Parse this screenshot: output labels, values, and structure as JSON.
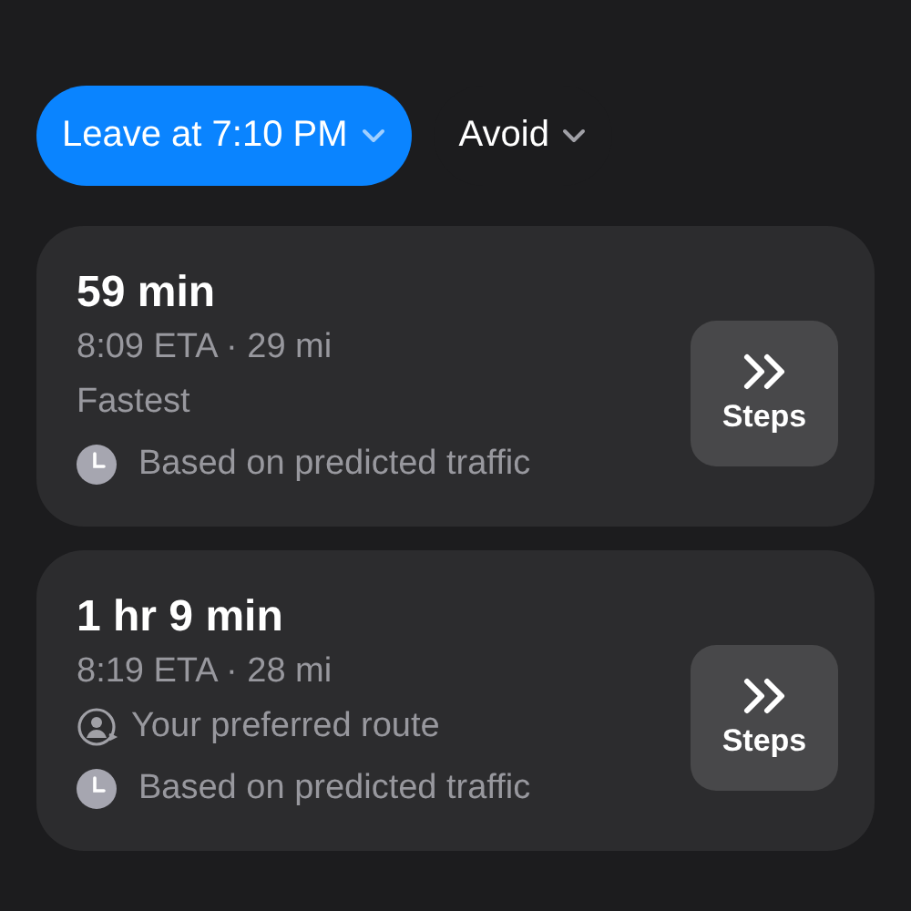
{
  "filters": [
    {
      "label": "Leave at 7:10 PM",
      "selected": true
    },
    {
      "label": "Avoid",
      "selected": false
    }
  ],
  "routes": [
    {
      "duration": "59 min",
      "details": "8:09 ETA · 29 mi",
      "notes": [
        {
          "kind": "plain",
          "text": "Fastest"
        },
        {
          "kind": "traffic",
          "text": "Based on predicted traffic"
        }
      ],
      "button": "Steps"
    },
    {
      "duration": "1 hr 9 min",
      "details": "8:19 ETA · 28 mi",
      "notes": [
        {
          "kind": "preferred",
          "text": "Your preferred route"
        },
        {
          "kind": "traffic",
          "text": "Based on predicted traffic"
        }
      ],
      "button": "Steps"
    }
  ]
}
